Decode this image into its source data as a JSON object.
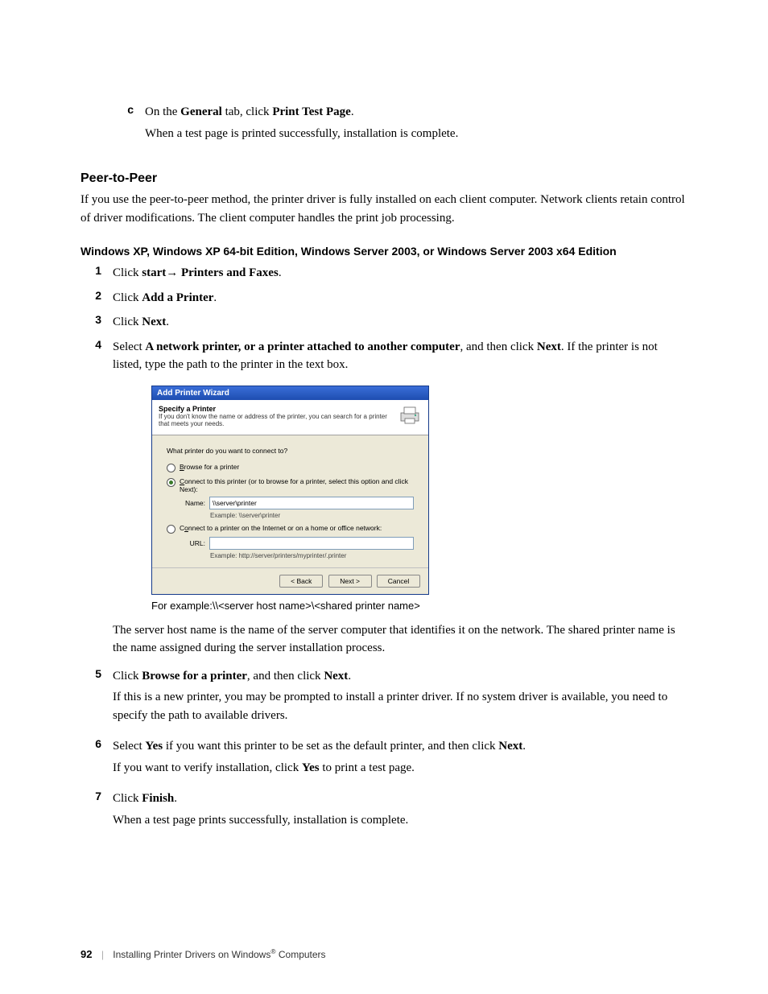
{
  "step_c": {
    "marker": "c",
    "line1_pre": "On the ",
    "line1_bold1": "General",
    "line1_mid": " tab, click ",
    "line1_bold2": "Print Test Page",
    "line1_post": ".",
    "line2": "When a test page is printed successfully, installation is complete."
  },
  "section_title": "Peer-to-Peer",
  "section_body": "If you use the peer-to-peer method, the printer driver is fully installed on each client computer. Network clients retain control of driver modifications. The client computer handles the print job processing.",
  "subsection_title": "Windows XP, Windows XP 64-bit Edition, Windows Server 2003, or Windows Server 2003 x64 Edition",
  "steps": {
    "s1": {
      "marker": "1",
      "pre": "Click ",
      "bold": "start→ Printers and Faxes",
      "post": "."
    },
    "s2": {
      "marker": "2",
      "pre": "Click ",
      "bold": "Add a Printer",
      "post": "."
    },
    "s3": {
      "marker": "3",
      "pre": "Click ",
      "bold": "Next",
      "post": "."
    },
    "s4": {
      "marker": "4",
      "pre": "Select ",
      "bold1": "A network printer, or a printer attached to another computer",
      "mid": ", and then click ",
      "bold2": "Next",
      "post": ". If the printer is not listed, type the path to the printer in the text box."
    },
    "s5": {
      "marker": "5",
      "pre": "Click ",
      "bold1": "Browse for a printer",
      "mid": ", and then click ",
      "bold2": "Next",
      "post": ".",
      "para": "If this is a new printer, you may be prompted to install a printer driver. If no system driver is available, you need to specify the path to available drivers."
    },
    "s6": {
      "marker": "6",
      "pre": "Select ",
      "bold1": "Yes",
      "mid": " if you want this printer to be set as the default printer, and then click ",
      "bold2": "Next",
      "post": ".",
      "para_pre": "If you want to verify installation, click ",
      "para_bold": "Yes",
      "para_post": " to print a test page."
    },
    "s7": {
      "marker": "7",
      "pre": "Click ",
      "bold": "Finish",
      "post": ".",
      "para": "When a test page prints successfully, installation is complete."
    }
  },
  "dialog": {
    "title": "Add Printer Wizard",
    "header_title": "Specify a Printer",
    "header_sub": "If you don't know the name or address of the printer, you can search for a printer that meets your needs.",
    "question": "What printer do you want to connect to?",
    "opt1": "Browse for a printer",
    "opt2": "Connect to this printer (or to browse for a printer, select this option and click Next):",
    "name_label": "Name:",
    "name_value": "\\\\server\\printer",
    "name_example": "Example: \\\\server\\printer",
    "opt3": "Connect to a printer on the Internet or on a home or office network:",
    "url_label": "URL:",
    "url_value": "",
    "url_example": "Example: http://server/printers/myprinter/.printer",
    "btn_back": "< Back",
    "btn_next": "Next >",
    "btn_cancel": "Cancel"
  },
  "caption": "For example:\\\\<server host name>\\<shared printer name>",
  "caption_note": "The server host name is the name of the server computer that identifies it on the network. The shared printer name is the name assigned during the server installation process.",
  "footer": {
    "page_num": "92",
    "chapter_pre": "Installing Printer Drivers on Windows",
    "reg": "®",
    "chapter_post": " Computers"
  }
}
